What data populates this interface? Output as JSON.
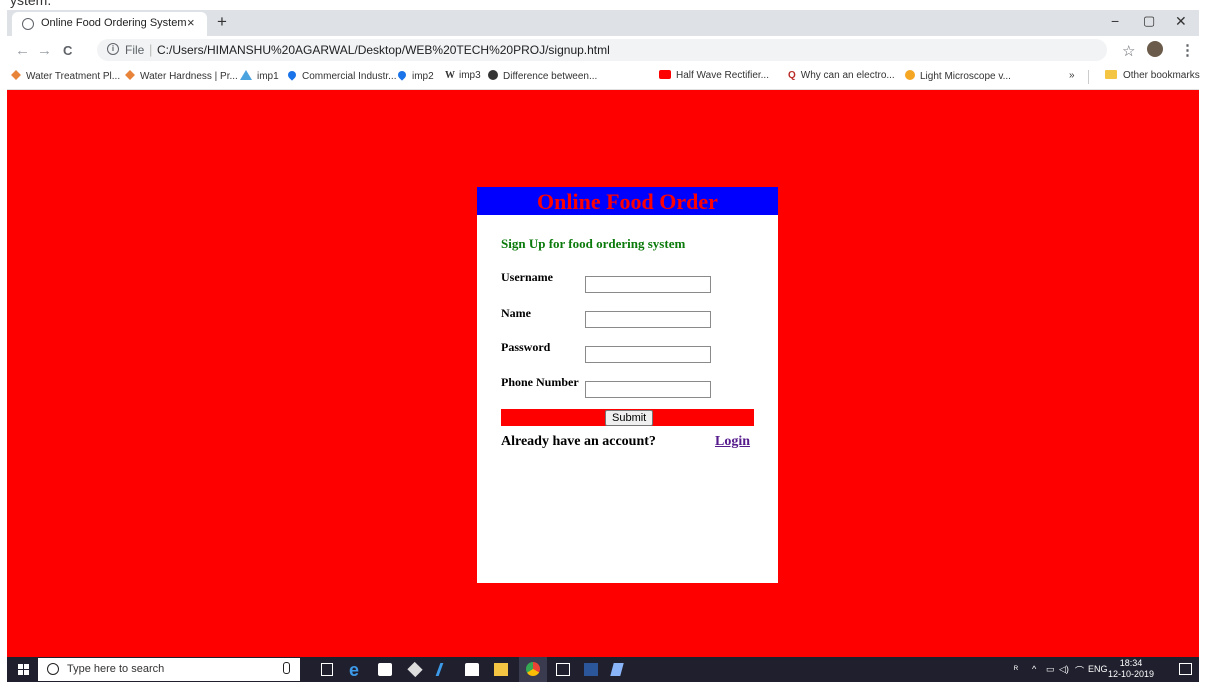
{
  "browser": {
    "cropped_title": "ystem.",
    "tab": {
      "title": "Online Food Ordering System",
      "close": "×"
    },
    "new_tab": "+",
    "window_controls": {
      "minimize": "−",
      "maximize": "▢",
      "close": "✕"
    },
    "nav": {
      "back": "←",
      "forward": "→",
      "reload": "C"
    },
    "omnibox": {
      "scheme": "File",
      "separator": "|",
      "url": "C:/Users/HIMANSHU%20AGARWAL/Desktop/WEB%20TECH%20PROJ/signup.html"
    },
    "star": "☆",
    "menu": "⋮",
    "bookmarks": [
      {
        "label": "Water Treatment Pl...",
        "icon": "diamond-icon",
        "color": "#e8833a"
      },
      {
        "label": "Water Hardness | Pr...",
        "icon": "diamond-icon",
        "color": "#e8833a"
      },
      {
        "label": "imp1",
        "icon": "triangle-icon",
        "color": "#4aa3df"
      },
      {
        "label": "Commercial Industr...",
        "icon": "drop-icon",
        "color": "#1a73e8"
      },
      {
        "label": "imp2",
        "icon": "drop-icon",
        "color": "#1a73e8"
      },
      {
        "label": "imp3",
        "icon": "w-icon",
        "color": "#000000"
      },
      {
        "label": "Difference between...",
        "icon": "b-icon",
        "color": "#333333"
      },
      {
        "label": "Half Wave Rectifier...",
        "icon": "youtube-icon",
        "color": "#ff0000"
      },
      {
        "label": "Why can an electro...",
        "icon": "q-icon",
        "color": "#b92b27"
      },
      {
        "label": "Light Microscope v...",
        "icon": "d-icon",
        "color": "#f5a623"
      }
    ],
    "bookmarks_more": "»",
    "other_bookmarks": "Other bookmarks"
  },
  "colors": {
    "page_bg": "#ff0000",
    "header_bg": "#0000ff",
    "header_text": "#ff0000",
    "subtitle": "#0a7a0a",
    "link": "#551a8b"
  },
  "form": {
    "header": "Online Food Order",
    "subtitle": "Sign Up for food ordering system",
    "fields": [
      {
        "label": "Username",
        "value": ""
      },
      {
        "label": "Name",
        "value": ""
      },
      {
        "label": "Password",
        "value": ""
      },
      {
        "label": "Phone Number",
        "value": ""
      }
    ],
    "submit_label": "Submit",
    "already_text": "Already have an account?",
    "login_label": "Login"
  },
  "taskbar": {
    "search_placeholder": "Type here to search",
    "tray_lang": "ENG",
    "time": "18:34",
    "date": "12-10-2019"
  }
}
